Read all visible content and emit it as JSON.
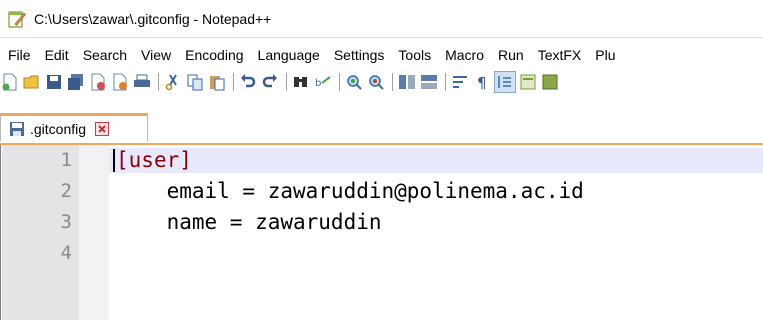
{
  "window": {
    "title": "C:\\Users\\zawar\\.gitconfig - Notepad++"
  },
  "menu": [
    "File",
    "Edit",
    "Search",
    "View",
    "Encoding",
    "Language",
    "Settings",
    "Tools",
    "Macro",
    "Run",
    "TextFX",
    "Plu"
  ],
  "toolbar": {
    "icons": [
      "new-file-icon",
      "open-file-icon",
      "save-icon",
      "save-all-icon",
      "close-icon",
      "close-all-icon",
      "print-icon",
      "cut-icon",
      "copy-icon",
      "paste-icon",
      "undo-icon",
      "redo-icon",
      "find-icon",
      "replace-icon",
      "zoom-in-icon",
      "zoom-out-icon",
      "sync-vertical-icon",
      "sync-horizontal-icon",
      "word-wrap-icon",
      "show-all-chars-icon",
      "indent-guide-icon",
      "document-map-icon",
      "function-list-icon"
    ]
  },
  "tabs": [
    {
      "label": ".gitconfig",
      "active": true
    }
  ],
  "editor": {
    "line_numbers": [
      "1",
      "2",
      "3",
      "4"
    ],
    "lines": {
      "l1_open": "[",
      "l1_name": "user",
      "l1_close": "]",
      "l2": "    email = zawaruddin@polinema.ac.id",
      "l3": "    name = zawaruddin"
    }
  },
  "colors": {
    "tab_accent": "#f1a65e",
    "current_line": "#e8e8ff",
    "section_color": "#8b0000",
    "gutter": "#e4e4e4"
  }
}
